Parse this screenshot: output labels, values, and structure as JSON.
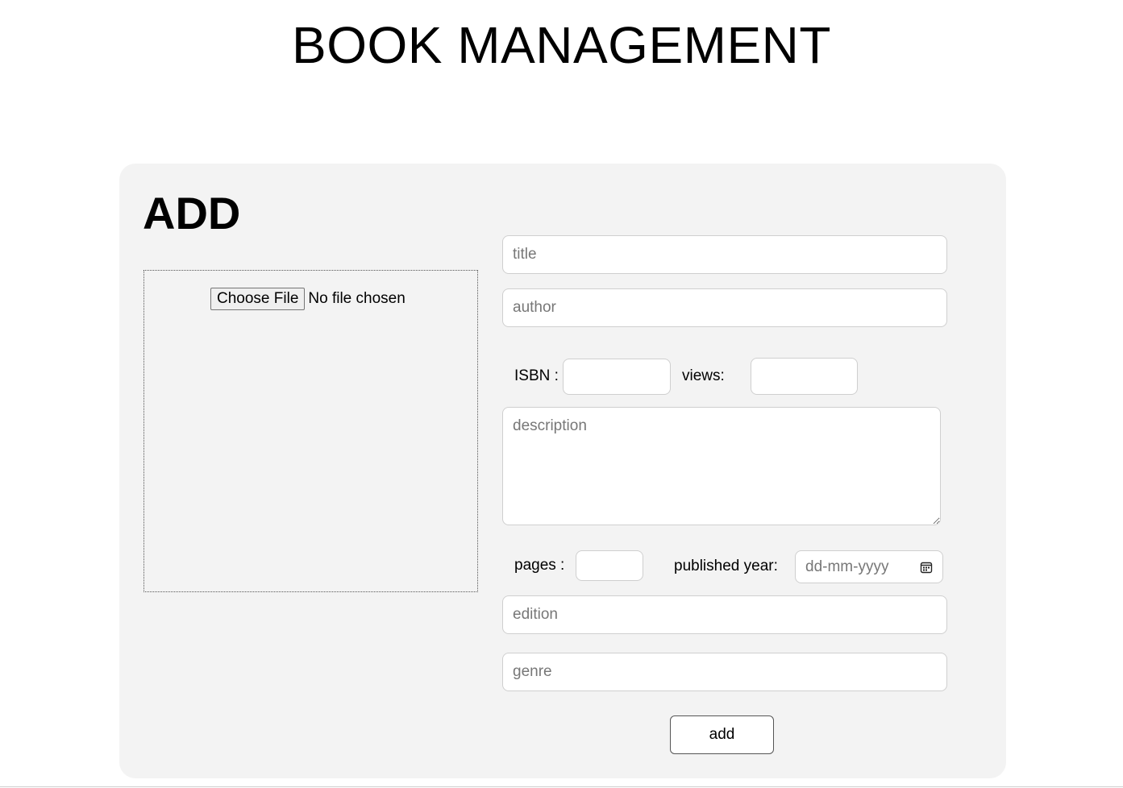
{
  "header": {
    "title": "BOOK MANAGEMENT"
  },
  "form": {
    "heading": "ADD",
    "file_upload": {
      "button_label": "Choose File",
      "status": "No file chosen"
    },
    "title_field": {
      "placeholder": "title",
      "value": ""
    },
    "author_field": {
      "placeholder": "author",
      "value": ""
    },
    "isbn": {
      "label": "ISBN :",
      "value": ""
    },
    "views": {
      "label": "views:",
      "value": ""
    },
    "description_field": {
      "placeholder": "description",
      "value": ""
    },
    "pages": {
      "label": "pages :",
      "value": ""
    },
    "published_year": {
      "label": "published year:",
      "placeholder": "dd-mm-yyyy",
      "icon": "calendar-icon"
    },
    "edition_field": {
      "placeholder": "edition",
      "value": ""
    },
    "genre_field": {
      "placeholder": "genre",
      "value": ""
    },
    "submit_label": "add"
  },
  "colors": {
    "panel_background": "#f3f3f3",
    "page_background": "#ffffff",
    "input_border": "#cfcfcf"
  }
}
